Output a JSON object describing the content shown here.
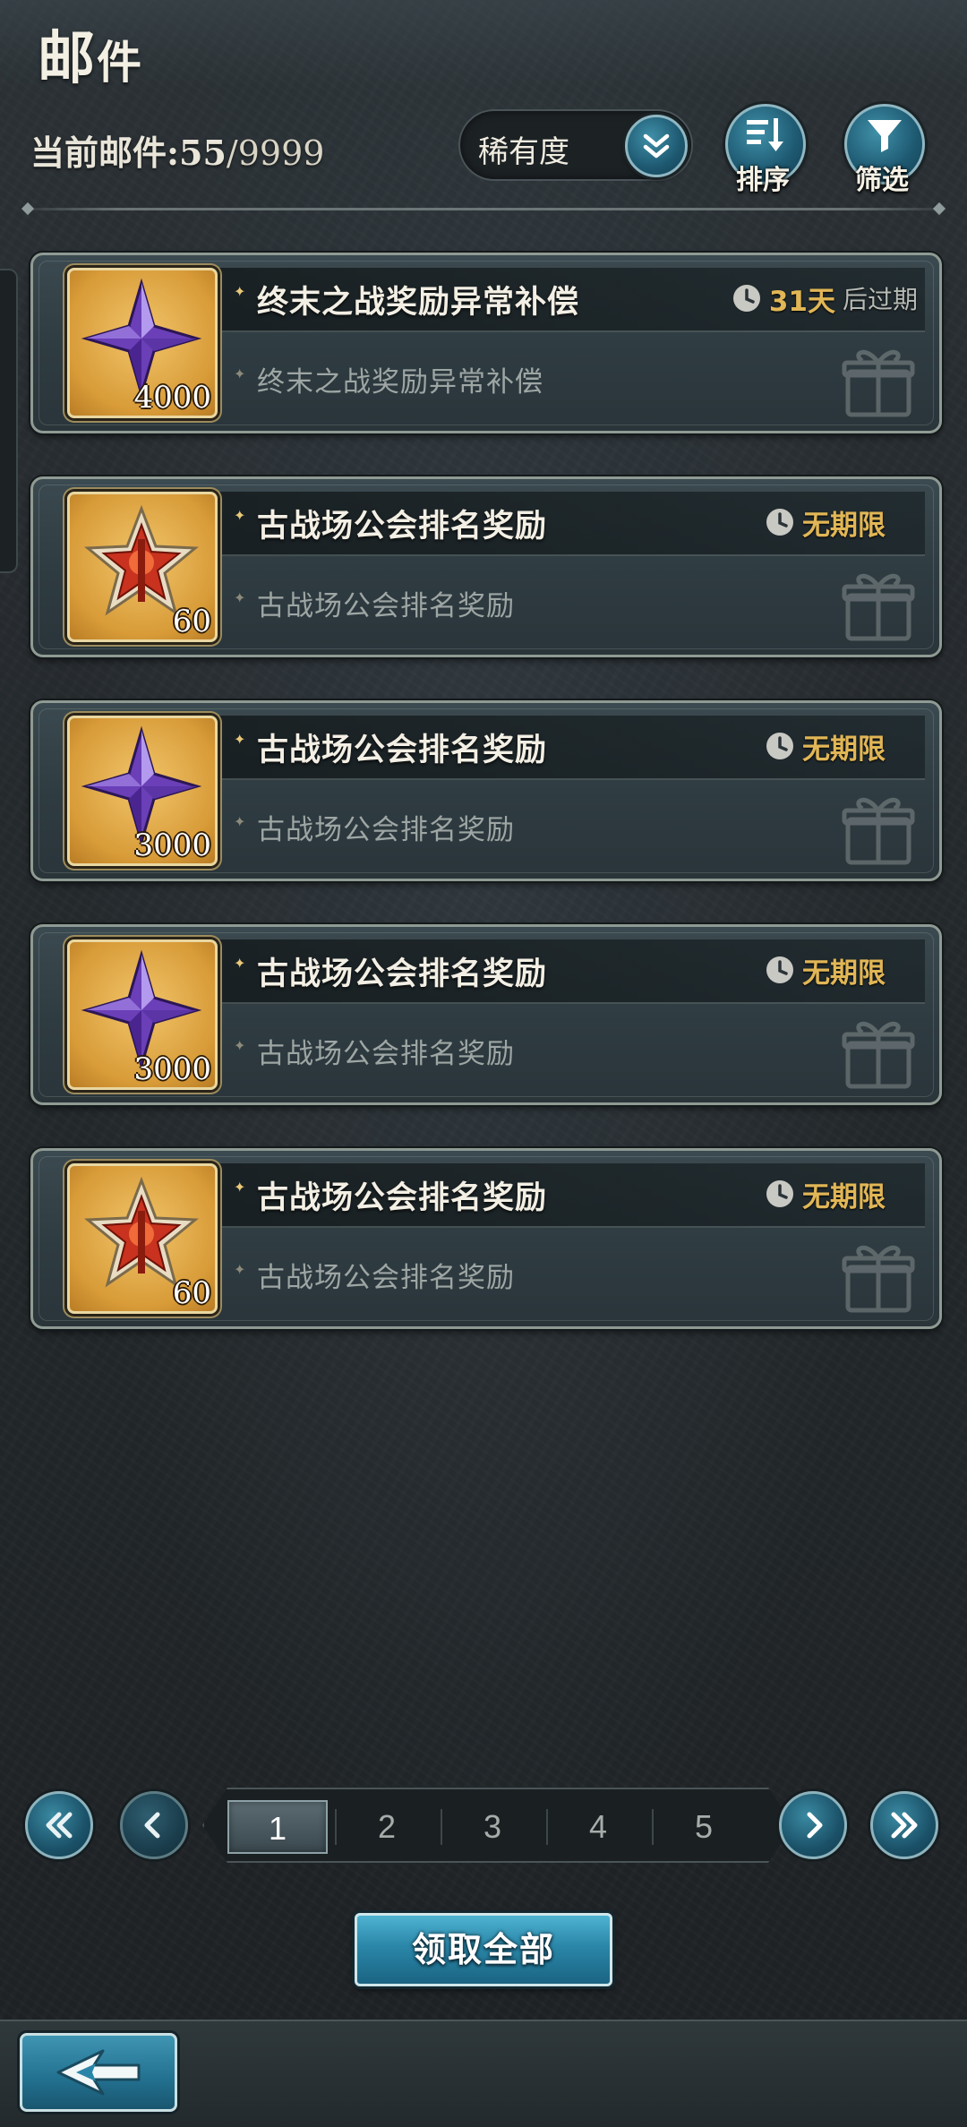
{
  "header": {
    "title_big": "邮",
    "title_small": "件",
    "mail_count_label": "当前邮件:",
    "mail_count_current": "55",
    "mail_count_total": "/9999"
  },
  "toolbar": {
    "rarity_label": "稀有度",
    "sort_label": "排序",
    "filter_label": "筛选"
  },
  "mails": [
    {
      "title": "终末之战奖励异常补偿",
      "subtitle": "终末之战奖励异常补偿",
      "expiry_value": "31天",
      "expiry_suffix": "后过期",
      "item_icon": "purple-star-crystal-icon",
      "item_qty": "4000"
    },
    {
      "title": "古战场公会排名奖励",
      "subtitle": "古战场公会排名奖励",
      "expiry_value": "无期限",
      "expiry_suffix": "",
      "item_icon": "red-star-medal-icon",
      "item_qty": "60"
    },
    {
      "title": "古战场公会排名奖励",
      "subtitle": "古战场公会排名奖励",
      "expiry_value": "无期限",
      "expiry_suffix": "",
      "item_icon": "purple-star-crystal-icon",
      "item_qty": "3000"
    },
    {
      "title": "古战场公会排名奖励",
      "subtitle": "古战场公会排名奖励",
      "expiry_value": "无期限",
      "expiry_suffix": "",
      "item_icon": "purple-star-crystal-icon",
      "item_qty": "3000"
    },
    {
      "title": "古战场公会排名奖励",
      "subtitle": "古战场公会排名奖励",
      "expiry_value": "无期限",
      "expiry_suffix": "",
      "item_icon": "red-star-medal-icon",
      "item_qty": "60"
    }
  ],
  "pagination": {
    "current_page": 1,
    "pages": [
      "1",
      "2",
      "3",
      "4",
      "5"
    ]
  },
  "actions": {
    "claim_all_label": "领取全部"
  },
  "colors": {
    "accent_blue": "#2a86a8",
    "expiry_gold": "#e1b656",
    "item_frame_gold": "#d89b38"
  }
}
